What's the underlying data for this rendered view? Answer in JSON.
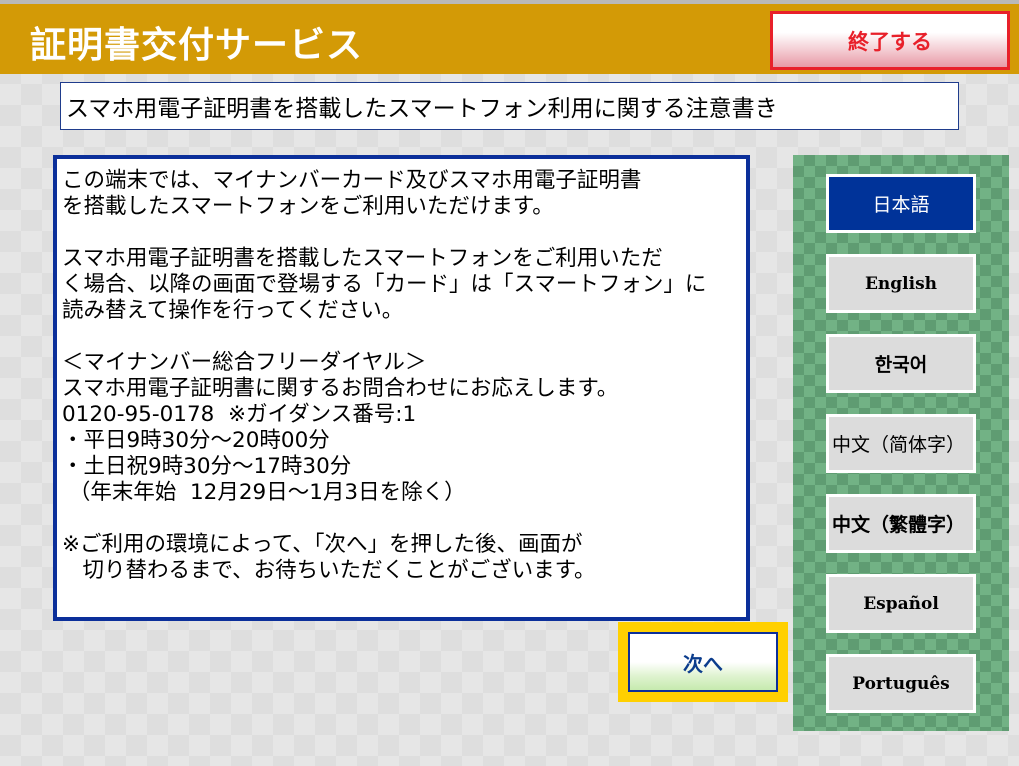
{
  "header": {
    "title": "証明書交付サービス",
    "exit_label": "終了する"
  },
  "subtitle": "スマホ用電子証明書を搭載したスマートフォン利用に関する注意書き",
  "notice": {
    "lines": [
      "この端末では、マイナンバーカード及びスマホ用電子証明書",
      "を搭載したスマートフォンをご利用いただけます。",
      "",
      "スマホ用電子証明書を搭載したスマートフォンをご利用いただ",
      "く場合、以降の画面で登場する「カード」は「スマートフォン」に",
      "読み替えて操作を行ってください。",
      "",
      "＜マイナンバー総合フリーダイヤル＞",
      "スマホ用電子証明書に関するお問合わせにお応えします。",
      "0120-95-0178  ※ガイダンス番号:1",
      "・平日9時30分～20時00分",
      "・土日祝9時30分～17時30分",
      " （年末年始  12月29日～1月3日を除く）",
      "",
      "※ご利用の環境によって、「次へ」を押した後、画面が",
      "   切り替わるまで、お待ちいただくことがございます。"
    ]
  },
  "next_label": "次へ",
  "languages": [
    {
      "label": "日本語",
      "selected": true
    },
    {
      "label": "English",
      "selected": false
    },
    {
      "label": "한국어",
      "selected": false
    },
    {
      "label": "中文（简体字）",
      "selected": false
    },
    {
      "label": "中文（繁體字）",
      "selected": false
    },
    {
      "label": "Español",
      "selected": false
    },
    {
      "label": "Português",
      "selected": false
    }
  ],
  "colors": {
    "header_bg": "#D39A06",
    "exit_accent": "#E8202A",
    "navy_border": "#0B2F9A",
    "selected_lang_bg": "#003399",
    "next_frame": "#FFD000",
    "lang_panel_green": "#72B285"
  }
}
